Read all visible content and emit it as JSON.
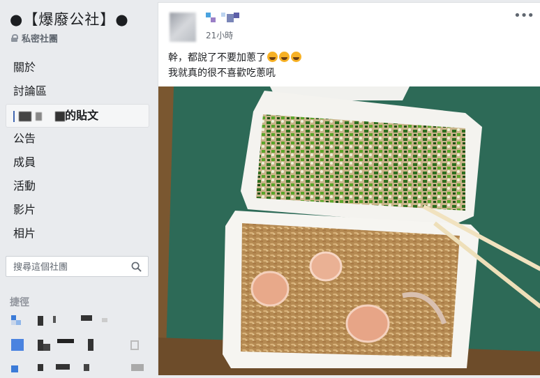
{
  "group": {
    "title": "●【爆廢公社】●",
    "privacy": "私密社團"
  },
  "nav": {
    "items": [
      {
        "label": "關於"
      },
      {
        "label": "討論區"
      },
      {
        "label": "的貼文"
      },
      {
        "label": "公告"
      },
      {
        "label": "成員"
      },
      {
        "label": "活動"
      },
      {
        "label": "影片"
      },
      {
        "label": "相片"
      }
    ]
  },
  "search": {
    "placeholder": "搜尋這個社團"
  },
  "shortcuts": {
    "heading": "捷徑"
  },
  "post": {
    "time": "21小時",
    "line1": "幹，都說了不要加蔥了",
    "line2": "我就真的很不喜歡吃蔥吼",
    "more": "•••"
  },
  "colors": {
    "accent": "#4267b2",
    "background": "#e9ebee",
    "table": "#2f6b5a"
  }
}
